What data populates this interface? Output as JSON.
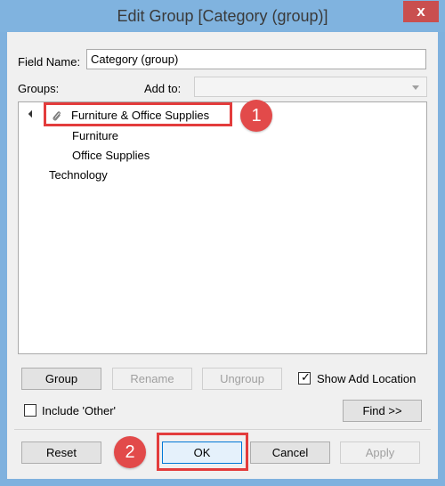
{
  "window": {
    "title": "Edit Group [Category (group)]",
    "close_glyph": "x"
  },
  "field_name": {
    "label": "Field Name:",
    "value": "Category (group)"
  },
  "groups": {
    "label": "Groups:",
    "add_to_label": "Add to:",
    "add_to_value": ""
  },
  "tree": {
    "group_name": "Furniture & Office Supplies",
    "children": [
      "Furniture",
      "Office Supplies"
    ],
    "ungrouped": [
      "Technology"
    ]
  },
  "buttons": {
    "group": "Group",
    "rename": "Rename",
    "ungroup": "Ungroup",
    "find": "Find >>",
    "reset": "Reset",
    "ok": "OK",
    "cancel": "Cancel",
    "apply": "Apply"
  },
  "checkboxes": {
    "show_add_location": {
      "label": "Show Add Location",
      "checked": true
    },
    "include_other": {
      "label": "Include 'Other'",
      "checked": false
    }
  },
  "annotations": {
    "callout_1": "1",
    "callout_2": "2",
    "accent_color": "#e33c3c"
  }
}
